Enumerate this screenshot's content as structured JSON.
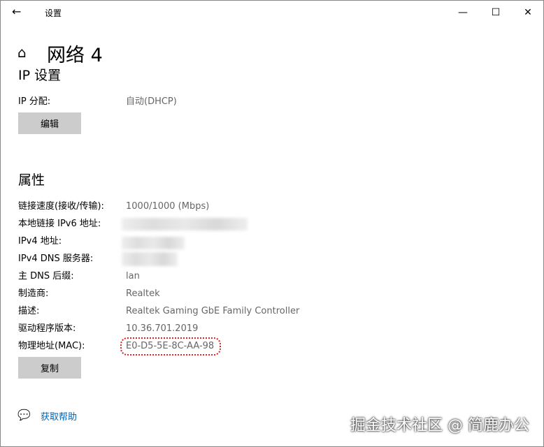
{
  "window": {
    "title": "设置",
    "minimize": "—",
    "maximize": "☐",
    "close": "✕",
    "back": "←"
  },
  "page": {
    "title": "网络 4",
    "home_icon": "⌂"
  },
  "ip_settings": {
    "heading": "IP 设置",
    "assign_label": "IP 分配:",
    "assign_value": "自动(DHCP)",
    "edit_button": "编辑"
  },
  "properties": {
    "heading": "属性",
    "rows": [
      {
        "label": "链接速度(接收/传输):",
        "value": "1000/1000 (Mbps)"
      },
      {
        "label": "本地链接 IPv6 地址:",
        "value": null
      },
      {
        "label": "IPv4 地址:",
        "value": null
      },
      {
        "label": "IPv4 DNS 服务器:",
        "value": null
      },
      {
        "label": "主 DNS 后缀:",
        "value": "lan"
      },
      {
        "label": "制造商:",
        "value": "Realtek"
      },
      {
        "label": "描述:",
        "value": "Realtek Gaming GbE Family Controller"
      },
      {
        "label": "驱动程序版本:",
        "value": "10.36.701.2019"
      },
      {
        "label": "物理地址(MAC):",
        "value": "E0-D5-5E-8C-AA-98"
      }
    ],
    "copy_button": "复制"
  },
  "help": {
    "label": "获取帮助"
  },
  "watermark": "掘金技术社区 @ 简鹿办公"
}
